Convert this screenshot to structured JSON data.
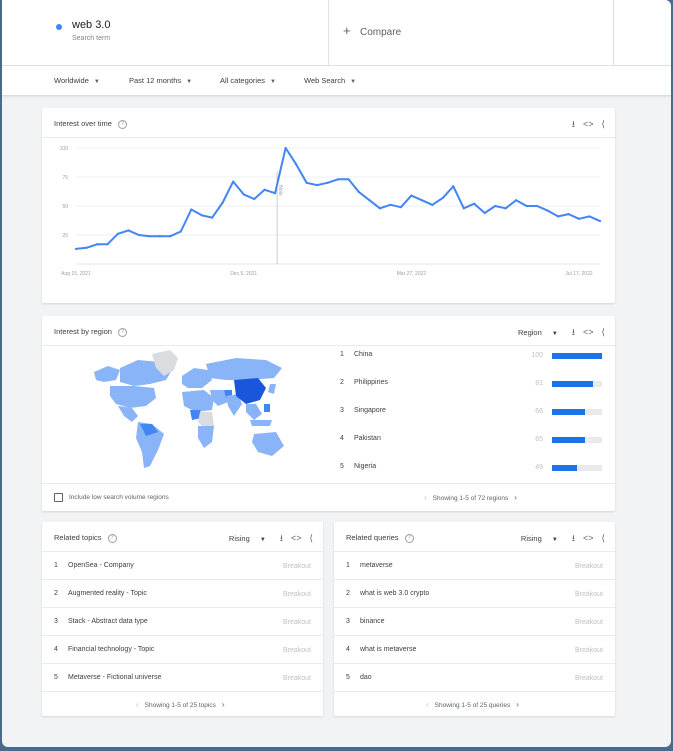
{
  "search": {
    "term": "web 3.0",
    "term_sub": "Search term",
    "compare_label": "Compare"
  },
  "filters": [
    {
      "label": "Worldwide"
    },
    {
      "label": "Past 12 months"
    },
    {
      "label": "All categories"
    },
    {
      "label": "Web Search"
    }
  ],
  "interest_over_time": {
    "title": "Interest over time",
    "annotation": "Note"
  },
  "chart_data": {
    "type": "line",
    "title": "Interest over time",
    "x": [
      "Aug 15, 2021",
      "Aug 22",
      "Aug 29",
      "Sep 5",
      "Sep 12",
      "Sep 19",
      "Sep 26",
      "Oct 3",
      "Oct 10",
      "Oct 17",
      "Oct 24",
      "Oct 31",
      "Nov 7",
      "Nov 14",
      "Nov 21",
      "Nov 28",
      "Dec 5, 2021",
      "Dec 12",
      "Dec 19",
      "Dec 26",
      "Jan 2",
      "Jan 9",
      "Jan 16",
      "Jan 23",
      "Jan 30",
      "Feb 6",
      "Feb 13",
      "Feb 20",
      "Feb 27",
      "Mar 6",
      "Mar 13",
      "Mar 20",
      "Mar 27, 2022",
      "Apr 3",
      "Apr 10",
      "Apr 17",
      "Apr 24",
      "May 1",
      "May 8",
      "May 15",
      "May 22",
      "May 29",
      "Jun 5",
      "Jun 12",
      "Jun 19",
      "Jun 26",
      "Jul 3",
      "Jul 10",
      "Jul 17, 2022",
      "Jul 24",
      "Jul 31"
    ],
    "values": [
      13,
      14,
      17,
      17,
      26,
      29,
      25,
      24,
      24,
      24,
      28,
      47,
      42,
      40,
      53,
      71,
      60,
      56,
      64,
      61,
      100,
      86,
      70,
      68,
      70,
      73,
      73,
      62,
      55,
      48,
      51,
      49,
      59,
      55,
      51,
      57,
      67,
      48,
      52,
      44,
      50,
      48,
      55,
      50,
      50,
      46,
      41,
      43,
      39,
      41,
      37
    ],
    "x_ticks": [
      "Aug 15, 2021",
      "Dec 5, 2021",
      "Mar 27, 2022",
      "Jul 17, 2022"
    ],
    "y_ticks": [
      100,
      75,
      50,
      25
    ],
    "ylim": [
      0,
      100
    ],
    "grid": true,
    "color": "#4285f4"
  },
  "interest_by_region": {
    "title": "Interest by region",
    "region_select": "Region",
    "regions": [
      {
        "rank": "1",
        "name": "China",
        "value": "100",
        "level": 1.0
      },
      {
        "rank": "2",
        "name": "Philippines",
        "value": "81",
        "level": 0.81
      },
      {
        "rank": "3",
        "name": "Singapore",
        "value": "66",
        "level": 0.66
      },
      {
        "rank": "4",
        "name": "Pakistan",
        "value": "65",
        "level": 0.65
      },
      {
        "rank": "5",
        "name": "Nigeria",
        "value": "49",
        "level": 0.49
      }
    ],
    "low_volume_label": "Include low search volume regions",
    "pager": "Showing 1-5 of 72 regions"
  },
  "related_topics": {
    "title": "Related topics",
    "select": "Rising",
    "items": [
      {
        "rank": "1",
        "name": "OpenSea - Company",
        "value": "Breakout"
      },
      {
        "rank": "2",
        "name": "Augmented reality - Topic",
        "value": "Breakout"
      },
      {
        "rank": "3",
        "name": "Stack - Abstract data type",
        "value": "Breakout"
      },
      {
        "rank": "4",
        "name": "Financial technology - Topic",
        "value": "Breakout"
      },
      {
        "rank": "5",
        "name": "Metaverse - Fictional universe",
        "value": "Breakout"
      }
    ],
    "pager": "Showing 1-5 of 25 topics"
  },
  "related_queries": {
    "title": "Related queries",
    "select": "Rising",
    "items": [
      {
        "rank": "1",
        "name": "metaverse",
        "value": "Breakout"
      },
      {
        "rank": "2",
        "name": "what is web 3.0 crypto",
        "value": "Breakout"
      },
      {
        "rank": "3",
        "name": "binance",
        "value": "Breakout"
      },
      {
        "rank": "4",
        "name": "what is metaverse",
        "value": "Breakout"
      },
      {
        "rank": "5",
        "name": "dao",
        "value": "Breakout"
      }
    ],
    "pager": "Showing 1-5 of 25 queries"
  },
  "icons": {
    "download": "download-icon",
    "embed": "embed-icon",
    "share": "share-icon",
    "help": "help-icon"
  },
  "colors": {
    "accent": "#1a73e8",
    "line": "#4285f4",
    "map_high": "#1a56db",
    "map_mid": "#8ab4f8",
    "map_none": "#dadce0"
  }
}
